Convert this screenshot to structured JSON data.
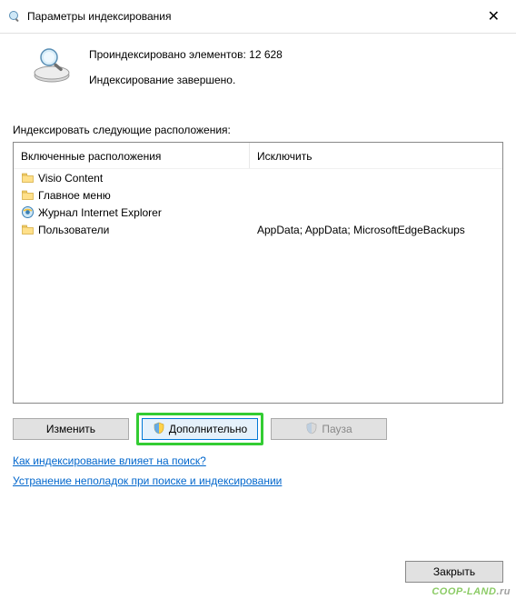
{
  "titlebar": {
    "title": "Параметры индексирования"
  },
  "status": {
    "indexed_label": "Проиндексировано элементов:",
    "indexed_count": "12 628",
    "complete": "Индексирование завершено."
  },
  "locations": {
    "label": "Индексировать следующие расположения:",
    "col_included": "Включенные расположения",
    "col_excluded": "Исключить",
    "rows": [
      {
        "icon": "folder",
        "name": "Visio Content",
        "exclude": ""
      },
      {
        "icon": "folder",
        "name": "Главное меню",
        "exclude": ""
      },
      {
        "icon": "ie",
        "name": "Журнал Internet Explorer",
        "exclude": ""
      },
      {
        "icon": "folder",
        "name": "Пользователи",
        "exclude": "AppData; AppData; MicrosoftEdgeBackups"
      }
    ]
  },
  "buttons": {
    "modify": "Изменить",
    "advanced": "Дополнительно",
    "pause": "Пауза",
    "close": "Закрыть"
  },
  "links": {
    "how_affects": "Как индексирование влияет на поиск?",
    "troubleshoot": "Устранение неполадок при поиске и индексировании"
  },
  "watermark": "COOP-LAND"
}
